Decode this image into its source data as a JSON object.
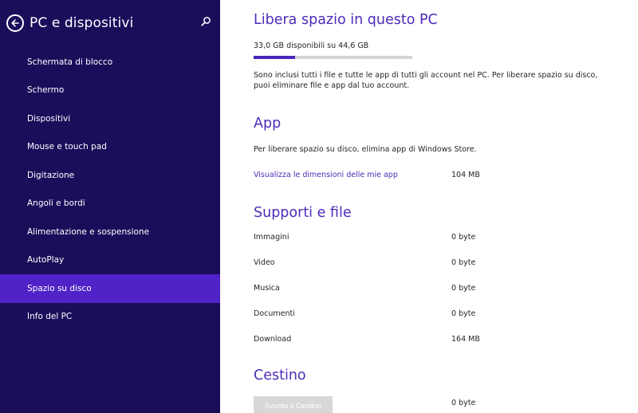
{
  "sidebar": {
    "title": "PC e dispositivi",
    "items": [
      {
        "label": "Schermata di blocco",
        "active": false
      },
      {
        "label": "Schermo",
        "active": false
      },
      {
        "label": "Dispositivi",
        "active": false
      },
      {
        "label": "Mouse e touch pad",
        "active": false
      },
      {
        "label": "Digitazione",
        "active": false
      },
      {
        "label": "Angoli e bordi",
        "active": false
      },
      {
        "label": "Alimentazione e sospensione",
        "active": false
      },
      {
        "label": "AutoPlay",
        "active": false
      },
      {
        "label": "Spazio su disco",
        "active": true
      },
      {
        "label": "Info del PC",
        "active": false
      }
    ],
    "icons": {
      "back": "back-arrow-icon",
      "search": "search-icon"
    }
  },
  "main": {
    "title": "Libera spazio in questo PC",
    "storage_text": "33,0 GB disponibili su 44,6 GB",
    "storage_used_fraction": 0.26,
    "description": "Sono inclusi tutti i file e tutte le app di tutti gli account nel PC. Per liberare spazio su disco, puoi eliminare file e app dal tuo account.",
    "app_section": {
      "title": "App",
      "text": "Per liberare spazio su disco, elimina app di Windows Store.",
      "link": "Visualizza le dimensioni delle mie app",
      "size": "104 MB"
    },
    "media_section": {
      "title": "Supporti e file",
      "rows": [
        {
          "label": "Immagini",
          "value": "0 byte"
        },
        {
          "label": "Video",
          "value": "0 byte"
        },
        {
          "label": "Musica",
          "value": "0 byte"
        },
        {
          "label": "Documenti",
          "value": "0 byte"
        },
        {
          "label": "Download",
          "value": "164 MB"
        }
      ]
    },
    "bin_section": {
      "title": "Cestino",
      "button": "Svuota il Cestino",
      "size": "0 byte"
    }
  },
  "colors": {
    "sidebar_bg": "#1c0d5b",
    "active_item": "#4f23c7",
    "accent": "#4f2bb8"
  }
}
